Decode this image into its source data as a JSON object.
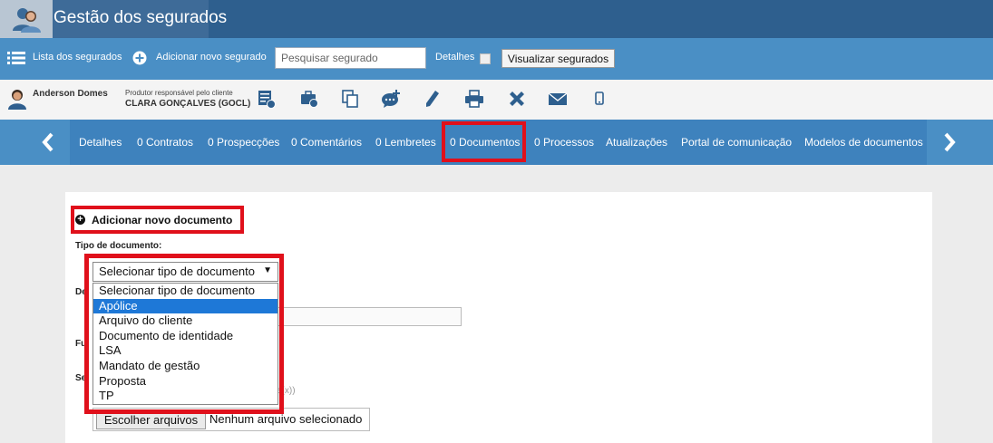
{
  "app": {
    "title": "Gestão dos segurados"
  },
  "toolbar": {
    "list_label": "Lista dos segurados",
    "add_label": "Adicionar novo segurado",
    "search_placeholder": "Pesquisar segurado",
    "details_label": "Detalhes",
    "details_checked": false,
    "view_button": "Visualizar segurados"
  },
  "client": {
    "name": "Anderson Domes",
    "producer_label": "Produtor responsável pelo cliente",
    "producer_value": "CLARA GONÇALVES (GOCL)",
    "actions": [
      "edit-doc-icon",
      "briefcase-add-icon",
      "copy-icon",
      "chat-add-icon",
      "pencil-icon",
      "print-icon",
      "close-icon",
      "mail-icon",
      "mobile-icon"
    ]
  },
  "tabs": [
    {
      "label": "Detalhes"
    },
    {
      "label": "0 Contratos"
    },
    {
      "label": "0 Prospecções"
    },
    {
      "label": "0 Comentários"
    },
    {
      "label": "0 Lembretes"
    },
    {
      "label": "0 Documentos",
      "active": true
    },
    {
      "label": "0 Processos"
    },
    {
      "label": "Atualizações"
    },
    {
      "label": "Portal de comunicação"
    },
    {
      "label": "Modelos de documentos"
    }
  ],
  "form": {
    "add_label": "Adicionar novo documento",
    "type_label": "Tipo de documento:",
    "desc_label_visible": "De",
    "func_label_visible": "Fu",
    "select_label_visible": "Se",
    "hint_visible": "a(x))",
    "select": {
      "value": "Selecionar tipo de documento",
      "highlighted": "Apólice",
      "options": [
        "Selecionar tipo de documento",
        "Apólice",
        "Arquivo do cliente",
        "Documento de identidade",
        "LSA",
        "Mandato de gestão",
        "Proposta",
        "TP"
      ]
    },
    "file_button": "Escolher arquivos",
    "file_status": "Nenhum arquivo selecionado"
  },
  "colors": {
    "titlebar": "#2e5f8e",
    "toolbar": "#4a8fc5",
    "highlight": "#e0101b",
    "selected_option": "#1e78d7"
  }
}
